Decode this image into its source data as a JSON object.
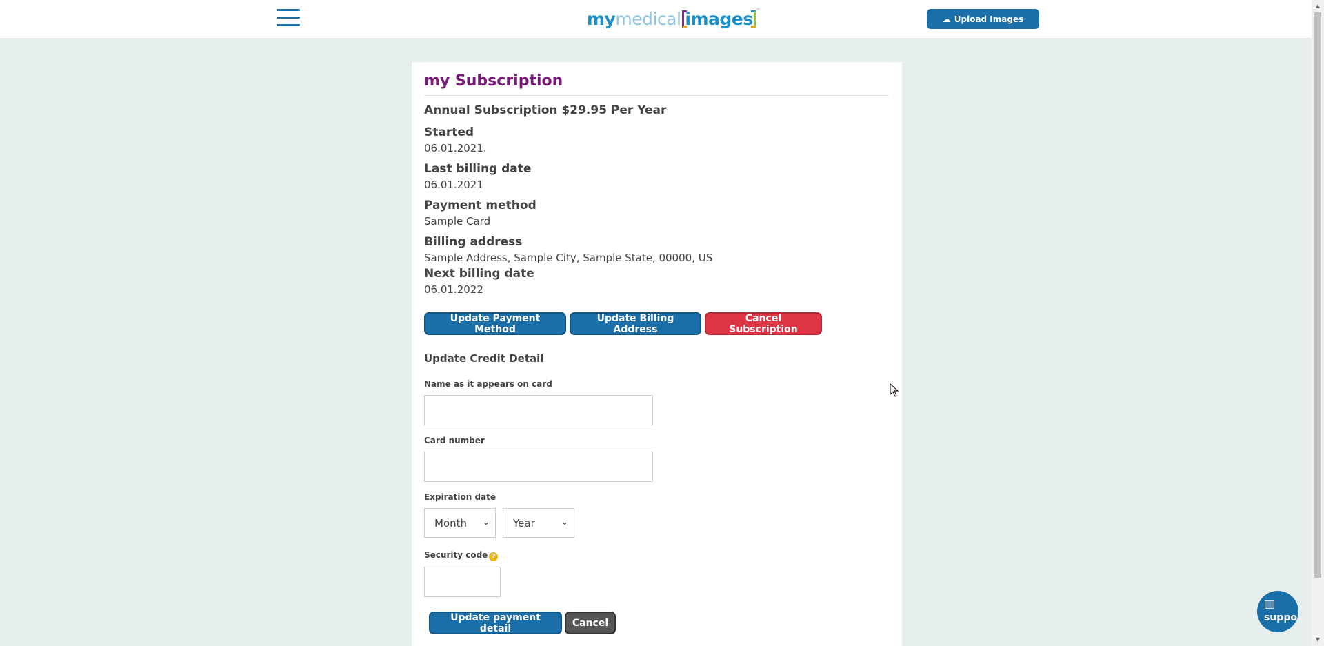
{
  "header": {
    "logo": {
      "my": "my",
      "medical": "medical",
      "images": "images",
      "tm": "™"
    },
    "upload_button": "Upload Images"
  },
  "subscription": {
    "title": "my Subscription",
    "plan": "Annual Subscription $29.95 Per Year",
    "started_label": "Started",
    "started_value": "06.01.2021.",
    "last_billing_label": "Last billing date",
    "last_billing_value": "06.01.2021",
    "payment_method_label": "Payment method",
    "payment_method_value": "Sample Card",
    "billing_address_label": "Billing address",
    "billing_address_value": "Sample Address, Sample City, Sample State, 00000, US",
    "next_billing_label": "Next billing date",
    "next_billing_value": "06.01.2022"
  },
  "actions": {
    "update_payment_method": "Update Payment Method",
    "update_billing_address": "Update Billing Address",
    "cancel_subscription": "Cancel Subscription"
  },
  "credit_form": {
    "section_title": "Update Credit Detail",
    "name_label": "Name as it appears on card",
    "name_value": "",
    "card_number_label": "Card number",
    "card_number_value": "",
    "expiration_label": "Expiration date",
    "month_selected": "Month",
    "year_selected": "Year",
    "security_code_label": "Security code",
    "security_code_value": "",
    "help_glyph": "?",
    "submit_button": "Update payment detail",
    "cancel_button": "Cancel"
  },
  "support_widget": {
    "label": "supportc"
  },
  "colors": {
    "brand_blue": "#1a6fa8",
    "title_purple": "#7a1a78",
    "danger_red": "#de3545",
    "background": "#e7eeee"
  }
}
